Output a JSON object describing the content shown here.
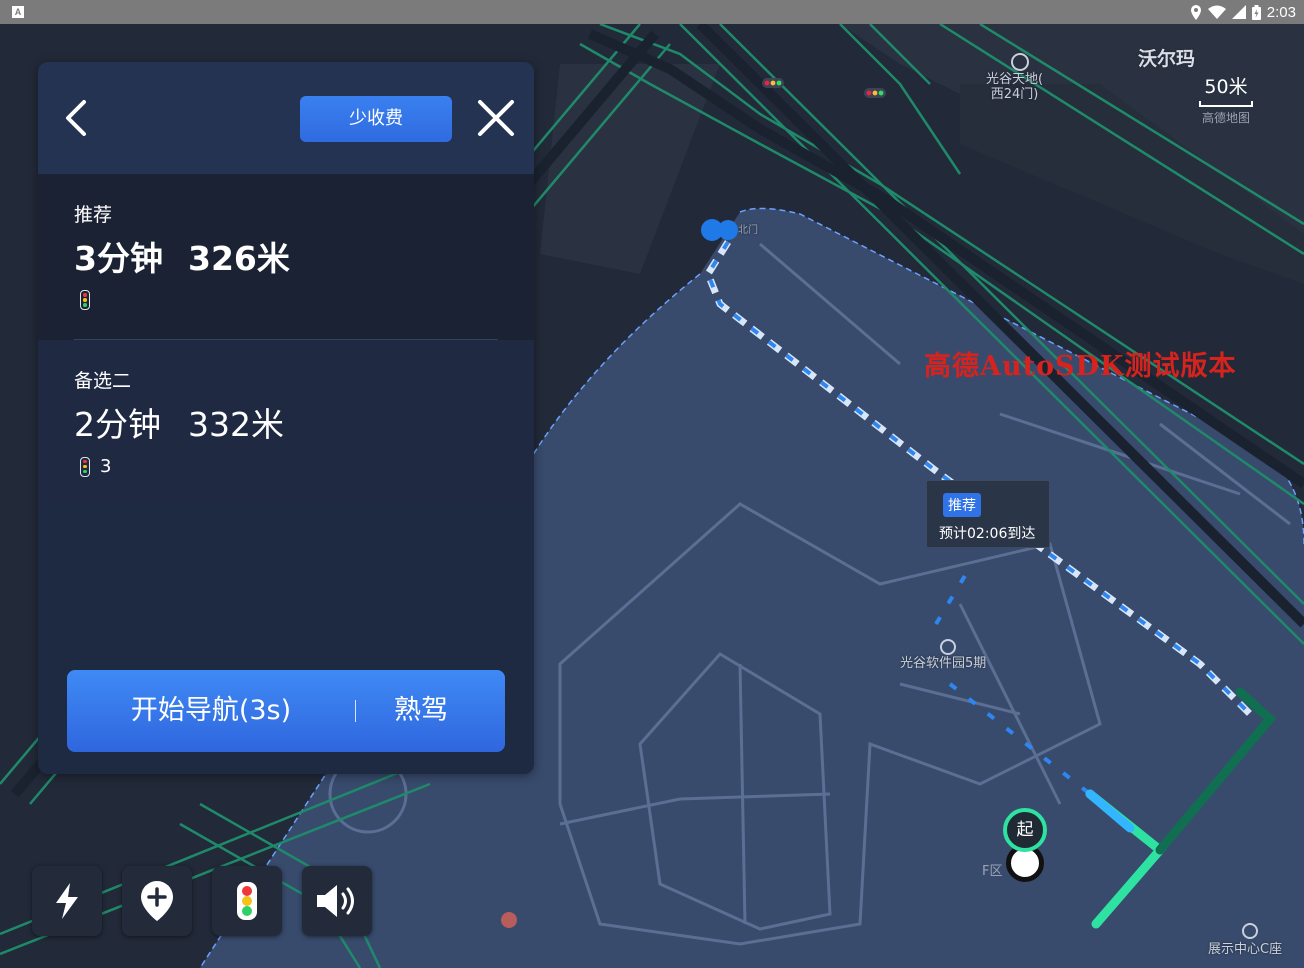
{
  "status_bar": {
    "app_badge": "A",
    "time": "2:03"
  },
  "map": {
    "poi_walmart": "沃尔玛",
    "poi_guanggu_tiandi": "光谷天地(\n西24门)",
    "poi_software_park": "光谷软件园5期",
    "poi_exhibition": "展示中心C座",
    "poi_north_gate": "北门",
    "zone_label": "F区",
    "scale_value": "50米",
    "brand": "高德地图",
    "watermark": "高德AutoSDK测试版本",
    "route_bubble": {
      "tag": "推荐",
      "eta": "预计02:06到达"
    },
    "start_marker": "起"
  },
  "panel": {
    "filter_button": "少收费",
    "routes": [
      {
        "label": "推荐",
        "time": "3分钟",
        "distance": "326米",
        "traffic_lights": ""
      },
      {
        "label": "备选二",
        "time": "2分钟",
        "distance": "332米",
        "traffic_lights": "3"
      }
    ],
    "start_nav_label": "开始导航(3s)",
    "familiar_label": "熟驾"
  },
  "toolbar": {
    "icons": [
      "lightning-icon",
      "add-location-icon",
      "traffic-light-icon",
      "volume-icon"
    ]
  },
  "colors": {
    "panel_bg": "#1e2a42",
    "accent_blue": "#2f73e6",
    "route_green": "#2ee2a2",
    "watermark_red": "#d6231e"
  }
}
